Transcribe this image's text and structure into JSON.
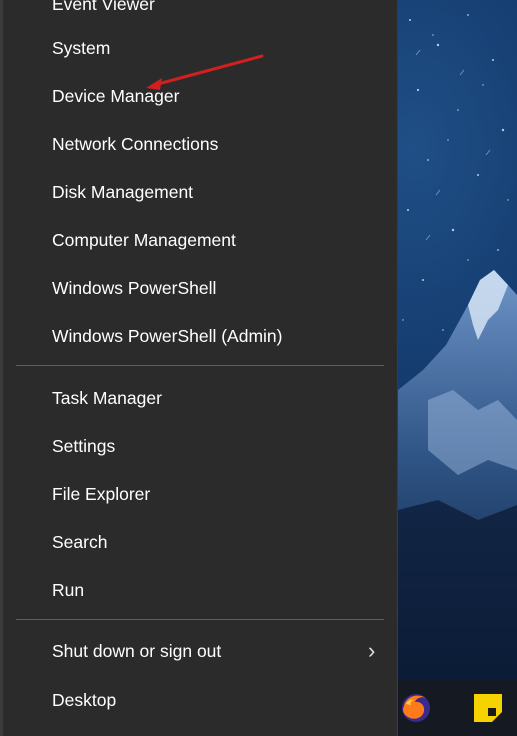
{
  "menu": {
    "items_top": [
      {
        "label": "Event Viewer"
      },
      {
        "label": "System"
      },
      {
        "label": "Device Manager"
      },
      {
        "label": "Network Connections"
      },
      {
        "label": "Disk Management"
      },
      {
        "label": "Computer Management"
      },
      {
        "label": "Windows PowerShell"
      },
      {
        "label": "Windows PowerShell (Admin)"
      }
    ],
    "items_mid": [
      {
        "label": "Task Manager"
      },
      {
        "label": "Settings"
      },
      {
        "label": "File Explorer"
      },
      {
        "label": "Search"
      },
      {
        "label": "Run"
      }
    ],
    "items_bottom": [
      {
        "label": "Shut down or sign out"
      },
      {
        "label": "Desktop"
      }
    ],
    "submenu_glyph": "›"
  },
  "taskbar": {
    "icons": [
      "firefox-icon",
      "sticky-notes-icon"
    ]
  },
  "colors": {
    "menu_background": "#2b2b2b",
    "menu_text": "#ffffff",
    "separator": "#5e5e5e",
    "annotation_arrow": "#d22020"
  }
}
